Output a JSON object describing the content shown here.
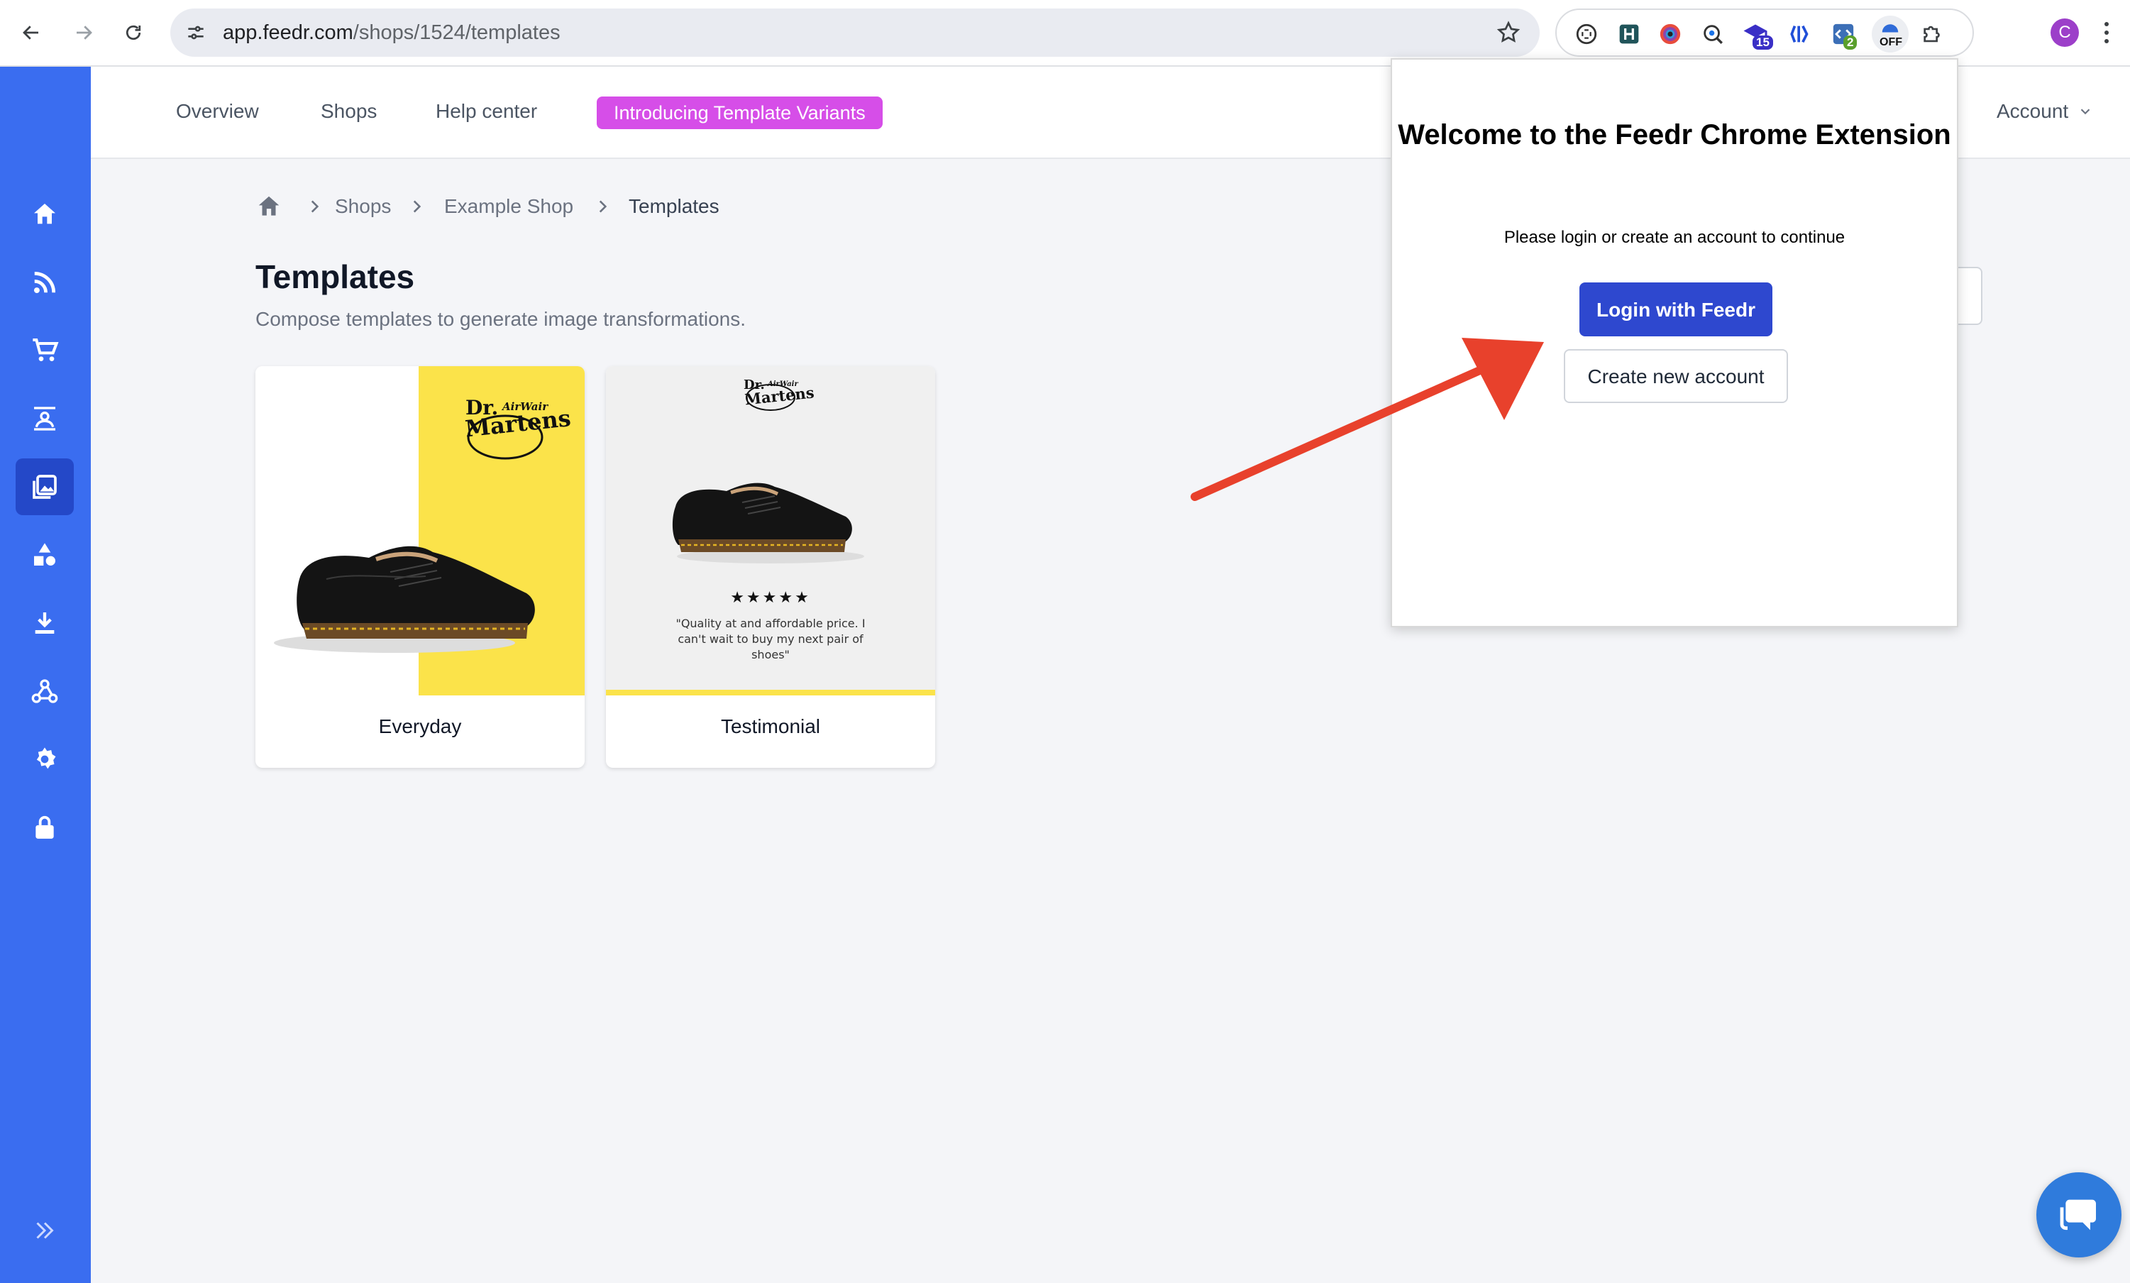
{
  "browser": {
    "url_host": "app.feedr.com",
    "url_path": "/shops/1524/templates",
    "profile_initial": "C",
    "extensions": [
      {
        "name": "capture-icon"
      },
      {
        "name": "h-extension-icon"
      },
      {
        "name": "color-picker-icon"
      },
      {
        "name": "search-lens-icon"
      },
      {
        "name": "academy-icon",
        "badge": "15"
      },
      {
        "name": "brackets-icon"
      },
      {
        "name": "code-extension-icon",
        "badge": "2"
      },
      {
        "name": "feedr-extension-icon",
        "badge": "OFF"
      },
      {
        "name": "puzzle-icon"
      }
    ]
  },
  "sidebar": {
    "items": [
      {
        "name": "home-icon"
      },
      {
        "name": "feed-icon"
      },
      {
        "name": "cart-icon"
      },
      {
        "name": "image-group-icon"
      },
      {
        "name": "templates-icon",
        "active": true
      },
      {
        "name": "shapes-icon"
      },
      {
        "name": "download-icon"
      },
      {
        "name": "webhook-icon"
      },
      {
        "name": "settings-icon"
      },
      {
        "name": "lock-icon"
      }
    ],
    "expand_icon": "double-chevron-right-icon"
  },
  "nav": {
    "overview": "Overview",
    "shops": "Shops",
    "help": "Help center",
    "promo": "Introducing Template Variants",
    "account": "Account"
  },
  "breadcrumb": {
    "items": [
      "Shops",
      "Example Shop",
      "Templates"
    ]
  },
  "page": {
    "title": "Templates",
    "subtitle": "Compose templates to generate image transformations."
  },
  "templates": [
    {
      "label": "Everyday",
      "brand": "Dr. Martens",
      "brand_small": "AirWair"
    },
    {
      "label": "Testimonial",
      "brand": "Dr. Martens",
      "brand_small": "AirWair",
      "rating": "★★★★★",
      "quote": "\"Quality at and affordable price. I can't wait to buy my next pair of shoes\""
    }
  ],
  "popup": {
    "title": "Welcome to the Feedr Chrome Extension",
    "message": "Please login or create an account to continue",
    "login_label": "Login with Feedr",
    "create_label": "Create new account"
  },
  "colors": {
    "sidebar": "#3a6df0",
    "sidebar_active": "#2448c8",
    "promo": "#d64ee8",
    "login_button": "#2e48cf",
    "annotation_arrow": "#e8412c",
    "card_accent_yellow": "#fbe34a"
  }
}
